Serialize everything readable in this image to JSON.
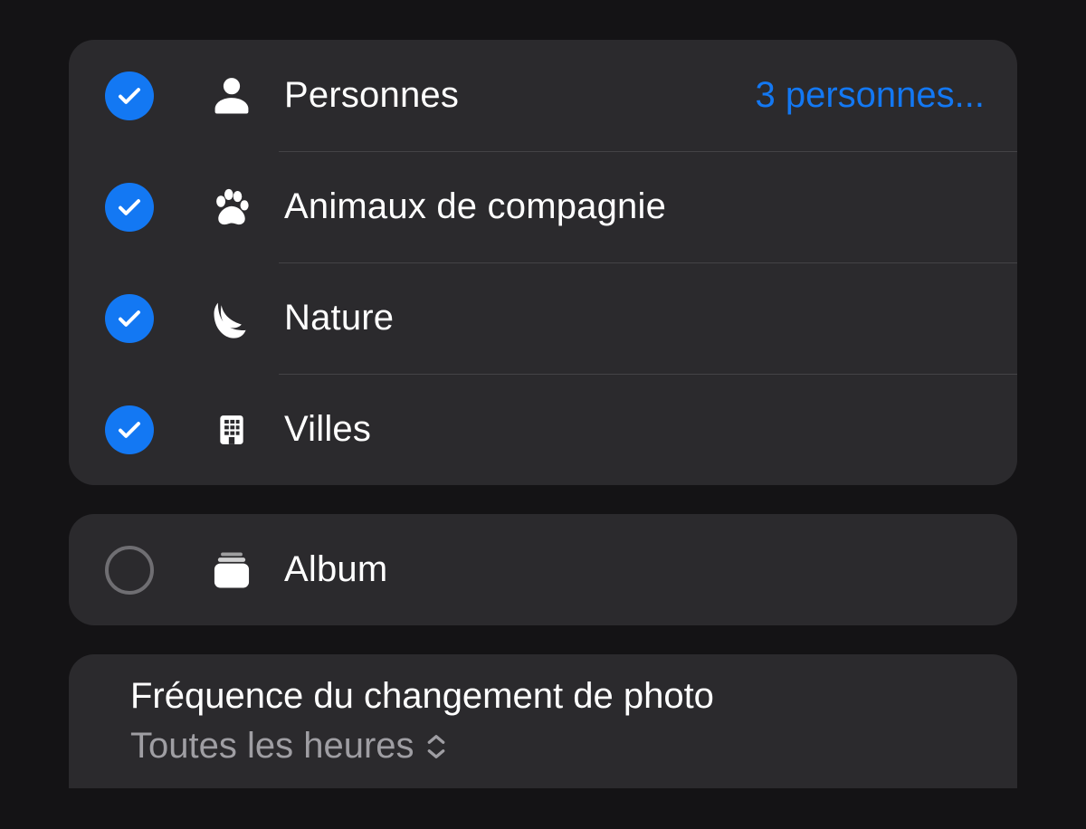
{
  "categories": [
    {
      "key": "people",
      "label": "Personnes",
      "checked": true,
      "detail": "3 personnes...",
      "icon": "person-icon"
    },
    {
      "key": "pets",
      "label": "Animaux de compagnie",
      "checked": true,
      "detail": "",
      "icon": "paw-icon"
    },
    {
      "key": "nature",
      "label": "Nature",
      "checked": true,
      "detail": "",
      "icon": "leaf-icon"
    },
    {
      "key": "cities",
      "label": "Villes",
      "checked": true,
      "detail": "",
      "icon": "building-icon"
    }
  ],
  "album": {
    "label": "Album",
    "checked": false,
    "icon": "album-icon"
  },
  "frequency": {
    "title": "Fréquence du changement de photo",
    "value": "Toutes les heures"
  },
  "colors": {
    "accent": "#1378f3"
  }
}
